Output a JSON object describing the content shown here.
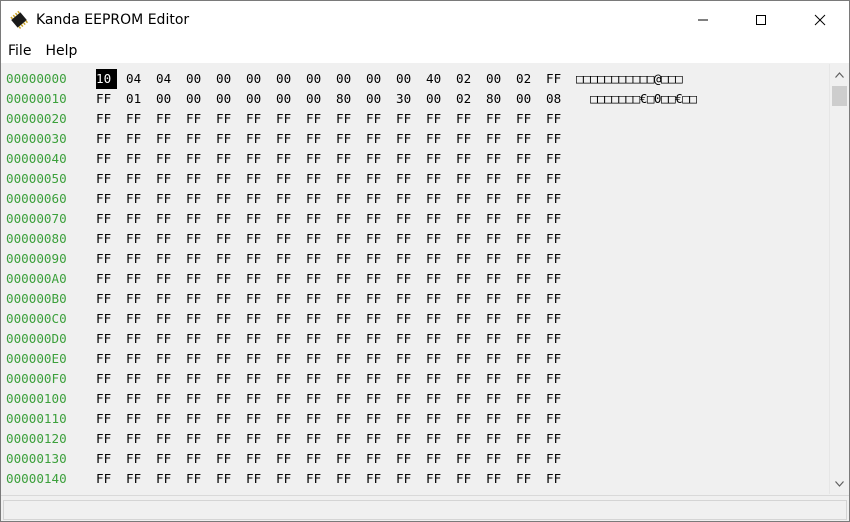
{
  "window": {
    "title": "Kanda EEPROM Editor",
    "icon": "chip-icon",
    "controls": [
      "minimize-icon",
      "maximize-icon",
      "close-icon"
    ]
  },
  "menu": {
    "items": [
      "File",
      "Help"
    ]
  },
  "hex_view": {
    "address_color": "#3ca03c",
    "selected_cell": {
      "row": 0,
      "col": 0
    },
    "rows": [
      {
        "address": "00000000",
        "bytes": [
          "10",
          "04",
          "04",
          "00",
          "00",
          "00",
          "00",
          "00",
          "00",
          "00",
          "00",
          "40",
          "02",
          "00",
          "02",
          "FF"
        ],
        "ascii": "□□□□□□□□□□□@□□□"
      },
      {
        "address": "00000010",
        "bytes": [
          "FF",
          "01",
          "00",
          "00",
          "00",
          "00",
          "00",
          "00",
          "80",
          "00",
          "30",
          "00",
          "02",
          "80",
          "00",
          "08"
        ],
        "ascii": "  □□□□□□□€□0□□€□□"
      },
      {
        "address": "00000020",
        "bytes": [
          "FF",
          "FF",
          "FF",
          "FF",
          "FF",
          "FF",
          "FF",
          "FF",
          "FF",
          "FF",
          "FF",
          "FF",
          "FF",
          "FF",
          "FF",
          "FF"
        ],
        "ascii": ""
      },
      {
        "address": "00000030",
        "bytes": [
          "FF",
          "FF",
          "FF",
          "FF",
          "FF",
          "FF",
          "FF",
          "FF",
          "FF",
          "FF",
          "FF",
          "FF",
          "FF",
          "FF",
          "FF",
          "FF"
        ],
        "ascii": ""
      },
      {
        "address": "00000040",
        "bytes": [
          "FF",
          "FF",
          "FF",
          "FF",
          "FF",
          "FF",
          "FF",
          "FF",
          "FF",
          "FF",
          "FF",
          "FF",
          "FF",
          "FF",
          "FF",
          "FF"
        ],
        "ascii": ""
      },
      {
        "address": "00000050",
        "bytes": [
          "FF",
          "FF",
          "FF",
          "FF",
          "FF",
          "FF",
          "FF",
          "FF",
          "FF",
          "FF",
          "FF",
          "FF",
          "FF",
          "FF",
          "FF",
          "FF"
        ],
        "ascii": ""
      },
      {
        "address": "00000060",
        "bytes": [
          "FF",
          "FF",
          "FF",
          "FF",
          "FF",
          "FF",
          "FF",
          "FF",
          "FF",
          "FF",
          "FF",
          "FF",
          "FF",
          "FF",
          "FF",
          "FF"
        ],
        "ascii": ""
      },
      {
        "address": "00000070",
        "bytes": [
          "FF",
          "FF",
          "FF",
          "FF",
          "FF",
          "FF",
          "FF",
          "FF",
          "FF",
          "FF",
          "FF",
          "FF",
          "FF",
          "FF",
          "FF",
          "FF"
        ],
        "ascii": ""
      },
      {
        "address": "00000080",
        "bytes": [
          "FF",
          "FF",
          "FF",
          "FF",
          "FF",
          "FF",
          "FF",
          "FF",
          "FF",
          "FF",
          "FF",
          "FF",
          "FF",
          "FF",
          "FF",
          "FF"
        ],
        "ascii": ""
      },
      {
        "address": "00000090",
        "bytes": [
          "FF",
          "FF",
          "FF",
          "FF",
          "FF",
          "FF",
          "FF",
          "FF",
          "FF",
          "FF",
          "FF",
          "FF",
          "FF",
          "FF",
          "FF",
          "FF"
        ],
        "ascii": ""
      },
      {
        "address": "000000A0",
        "bytes": [
          "FF",
          "FF",
          "FF",
          "FF",
          "FF",
          "FF",
          "FF",
          "FF",
          "FF",
          "FF",
          "FF",
          "FF",
          "FF",
          "FF",
          "FF",
          "FF"
        ],
        "ascii": ""
      },
      {
        "address": "000000B0",
        "bytes": [
          "FF",
          "FF",
          "FF",
          "FF",
          "FF",
          "FF",
          "FF",
          "FF",
          "FF",
          "FF",
          "FF",
          "FF",
          "FF",
          "FF",
          "FF",
          "FF"
        ],
        "ascii": ""
      },
      {
        "address": "000000C0",
        "bytes": [
          "FF",
          "FF",
          "FF",
          "FF",
          "FF",
          "FF",
          "FF",
          "FF",
          "FF",
          "FF",
          "FF",
          "FF",
          "FF",
          "FF",
          "FF",
          "FF"
        ],
        "ascii": ""
      },
      {
        "address": "000000D0",
        "bytes": [
          "FF",
          "FF",
          "FF",
          "FF",
          "FF",
          "FF",
          "FF",
          "FF",
          "FF",
          "FF",
          "FF",
          "FF",
          "FF",
          "FF",
          "FF",
          "FF"
        ],
        "ascii": ""
      },
      {
        "address": "000000E0",
        "bytes": [
          "FF",
          "FF",
          "FF",
          "FF",
          "FF",
          "FF",
          "FF",
          "FF",
          "FF",
          "FF",
          "FF",
          "FF",
          "FF",
          "FF",
          "FF",
          "FF"
        ],
        "ascii": ""
      },
      {
        "address": "000000F0",
        "bytes": [
          "FF",
          "FF",
          "FF",
          "FF",
          "FF",
          "FF",
          "FF",
          "FF",
          "FF",
          "FF",
          "FF",
          "FF",
          "FF",
          "FF",
          "FF",
          "FF"
        ],
        "ascii": ""
      },
      {
        "address": "00000100",
        "bytes": [
          "FF",
          "FF",
          "FF",
          "FF",
          "FF",
          "FF",
          "FF",
          "FF",
          "FF",
          "FF",
          "FF",
          "FF",
          "FF",
          "FF",
          "FF",
          "FF"
        ],
        "ascii": ""
      },
      {
        "address": "00000110",
        "bytes": [
          "FF",
          "FF",
          "FF",
          "FF",
          "FF",
          "FF",
          "FF",
          "FF",
          "FF",
          "FF",
          "FF",
          "FF",
          "FF",
          "FF",
          "FF",
          "FF"
        ],
        "ascii": ""
      },
      {
        "address": "00000120",
        "bytes": [
          "FF",
          "FF",
          "FF",
          "FF",
          "FF",
          "FF",
          "FF",
          "FF",
          "FF",
          "FF",
          "FF",
          "FF",
          "FF",
          "FF",
          "FF",
          "FF"
        ],
        "ascii": ""
      },
      {
        "address": "00000130",
        "bytes": [
          "FF",
          "FF",
          "FF",
          "FF",
          "FF",
          "FF",
          "FF",
          "FF",
          "FF",
          "FF",
          "FF",
          "FF",
          "FF",
          "FF",
          "FF",
          "FF"
        ],
        "ascii": ""
      },
      {
        "address": "00000140",
        "bytes": [
          "FF",
          "FF",
          "FF",
          "FF",
          "FF",
          "FF",
          "FF",
          "FF",
          "FF",
          "FF",
          "FF",
          "FF",
          "FF",
          "FF",
          "FF",
          "FF"
        ],
        "ascii": ""
      }
    ]
  },
  "scrollbar": {
    "up_icon": "chevron-up-icon",
    "down_icon": "chevron-down-icon"
  }
}
